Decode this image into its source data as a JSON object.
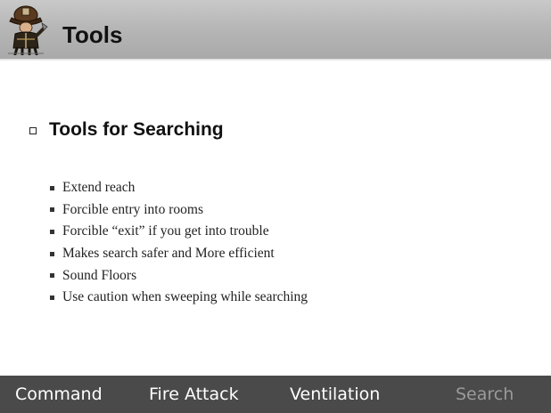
{
  "header": {
    "title": "Tools",
    "logo_icon": "firefighter-logo-icon"
  },
  "section": {
    "heading": "Tools for Searching",
    "bullet_icon": "hollow-square-bullet-icon"
  },
  "bullets": [
    "Extend reach",
    "Forcible entry into rooms",
    "Forcible “exit” if you get into trouble",
    "Makes search safer and More efficient",
    "Sound Floors",
    "Use caution when sweeping while searching"
  ],
  "nav": {
    "items": [
      {
        "label": "Command",
        "active": true
      },
      {
        "label": "Fire Attack",
        "active": true
      },
      {
        "label": "Ventilation",
        "active": true
      },
      {
        "label": "Search",
        "active": false
      }
    ]
  },
  "colors": {
    "title_bar": "#b7b7b7",
    "nav_bar": "#4a4a4a",
    "nav_text": "#ffffff",
    "nav_text_current": "#9a9a9a"
  }
}
